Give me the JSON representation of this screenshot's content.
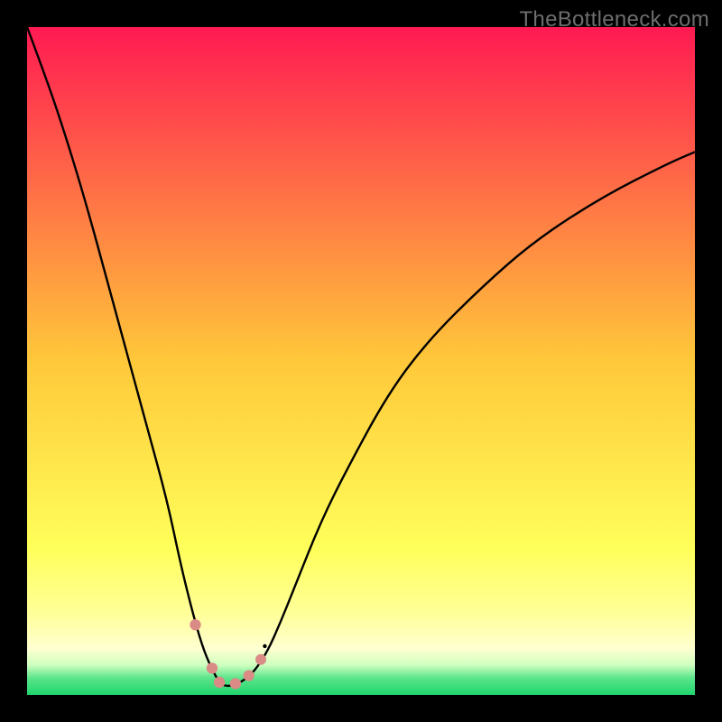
{
  "watermark": "TheBottleneck.com",
  "chart_data": {
    "type": "line",
    "title": "",
    "xlabel": "",
    "ylabel": "",
    "xlim": [
      0,
      100
    ],
    "ylim": [
      0,
      100
    ],
    "background_gradient": {
      "stops": [
        {
          "offset": 0.0,
          "color": "#ff1a52"
        },
        {
          "offset": 0.5,
          "color": "#ffc83a"
        },
        {
          "offset": 0.78,
          "color": "#ffff5a"
        },
        {
          "offset": 0.88,
          "color": "#ffff9a"
        },
        {
          "offset": 0.93,
          "color": "#ffffd0"
        },
        {
          "offset": 0.955,
          "color": "#cfffc0"
        },
        {
          "offset": 0.975,
          "color": "#5ae58a"
        },
        {
          "offset": 1.0,
          "color": "#1fd46c"
        }
      ]
    },
    "series": [
      {
        "name": "bottleneck-curve",
        "color": "#000000",
        "stroke_width": 2.4,
        "x": [
          0,
          3,
          6,
          9,
          12,
          15,
          18,
          21,
          23,
          25,
          26.5,
          28,
          29,
          30,
          31,
          32.5,
          34,
          36,
          38,
          40,
          44,
          48,
          54,
          60,
          68,
          76,
          86,
          96,
          100
        ],
        "y": [
          100,
          92,
          83,
          73,
          62,
          51,
          40,
          29,
          19.5,
          11.5,
          6.5,
          3.2,
          1.6,
          1.3,
          1.5,
          2.2,
          3.5,
          6.5,
          11,
          16,
          26,
          34,
          45,
          53,
          61,
          68,
          74.5,
          79.6,
          81.3
        ]
      }
    ],
    "markers": [
      {
        "name": "marker-left-upper",
        "x": 25.2,
        "y": 10.5,
        "r": 6.2,
        "color": "#db8b86"
      },
      {
        "name": "marker-left-main",
        "x": 27.7,
        "y": 4.0,
        "r": 6.2,
        "color": "#db8b86"
      },
      {
        "name": "marker-min-left",
        "x": 28.8,
        "y": 1.9,
        "r": 6.2,
        "color": "#db8b86"
      },
      {
        "name": "marker-min-right",
        "x": 31.2,
        "y": 1.7,
        "r": 6.2,
        "color": "#db8b86"
      },
      {
        "name": "marker-right-main",
        "x": 33.2,
        "y": 2.9,
        "r": 6.1,
        "color": "#db8b86"
      },
      {
        "name": "marker-right-upper",
        "x": 35.0,
        "y": 5.3,
        "r": 6.0,
        "color": "#db8b86"
      },
      {
        "name": "marker-right-dot",
        "x": 35.6,
        "y": 7.3,
        "r": 2.2,
        "color": "#000000"
      }
    ]
  }
}
